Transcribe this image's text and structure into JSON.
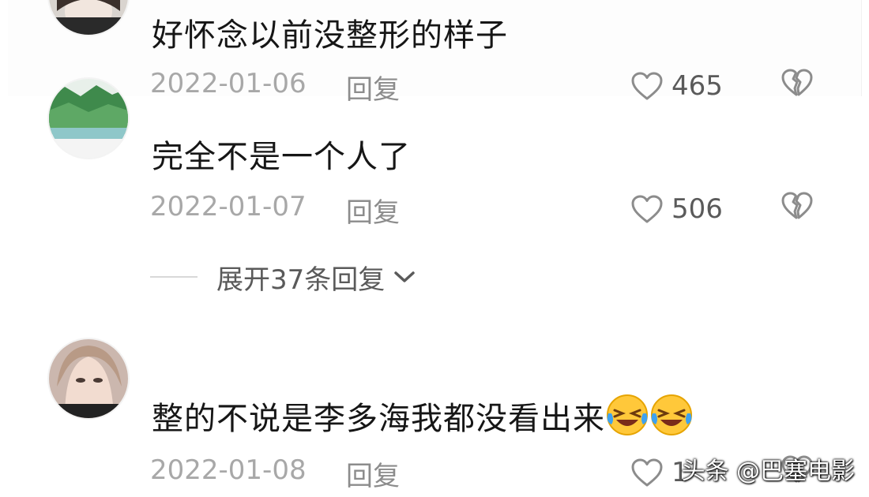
{
  "comments": [
    {
      "text": "好怀念以前没整形的样子",
      "date": "2022-01-06",
      "reply_label": "回复",
      "likes": "465"
    },
    {
      "text": "完全不是一个人了",
      "date": "2022-01-07",
      "reply_label": "回复",
      "likes": "506"
    },
    {
      "text": "整的不说是李多海我都没看出来",
      "date": "2022-01-08",
      "reply_label": "回复",
      "likes": "1"
    }
  ],
  "expand_replies": {
    "label": "展开37条回复"
  },
  "watermark": "头条 @巴塞电影",
  "icons": {
    "like": "heart-outline-icon",
    "dislike": "broken-heart-icon",
    "expand": "chevron-down-icon",
    "emoji": "laughing-crying-face-emoji"
  },
  "colors": {
    "text": "#161616",
    "meta": "#a8a8a8",
    "icon": "#8c8c8c"
  }
}
